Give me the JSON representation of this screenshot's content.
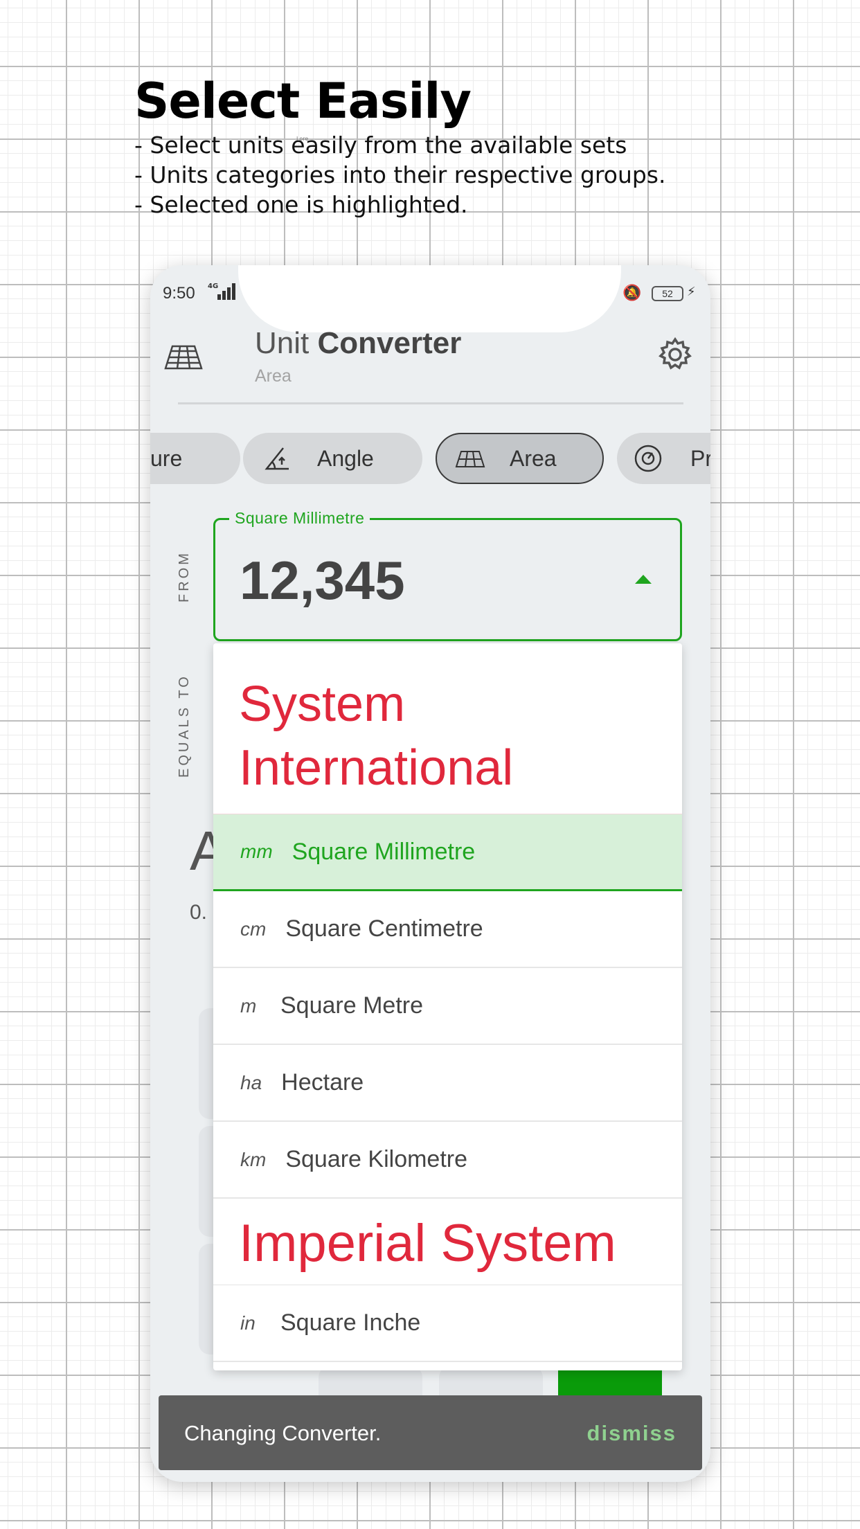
{
  "promo": {
    "title": "Select Easily",
    "tiny_text": "Lore",
    "lines": [
      "- Select units easily from the available sets",
      "- Units categories into their respective groups.",
      "- Selected one is highlighted."
    ]
  },
  "status_bar": {
    "time": "9:50",
    "network": "4G",
    "battery": "52"
  },
  "app": {
    "title_light": "Unit ",
    "title_bold": "Converter",
    "subtitle": "Area"
  },
  "categories": [
    {
      "label": "ure",
      "icon": "thermometer-icon"
    },
    {
      "label": "Angle",
      "icon": "angle-icon"
    },
    {
      "label": "Area",
      "icon": "area-grid-icon",
      "active": true
    },
    {
      "label": "Pr",
      "icon": "pressure-gauge-icon"
    }
  ],
  "side_labels": {
    "from": "FROM",
    "equals_to": "EQUALS TO"
  },
  "from_field": {
    "label": "Square Millimetre",
    "value": "12,345"
  },
  "background_result": {
    "big_letter": "A",
    "value": "0."
  },
  "dropdown": {
    "groups": [
      {
        "title": "System International",
        "units": [
          {
            "abbr": "mm",
            "name": "Square Millimetre",
            "selected": true
          },
          {
            "abbr": "cm",
            "name": "Square Centimetre"
          },
          {
            "abbr": "m",
            "name": "Square Metre"
          },
          {
            "abbr": "ha",
            "name": "Hectare"
          },
          {
            "abbr": "km",
            "name": "Square Kilometre"
          }
        ]
      },
      {
        "title": "Imperial System",
        "units": [
          {
            "abbr": "in",
            "name": "Square Inche"
          }
        ]
      }
    ]
  },
  "snackbar": {
    "message": "Changing Converter.",
    "action": "dismiss"
  },
  "colors": {
    "accent_green": "#1fa51f",
    "group_red": "#e0283c",
    "selected_bg": "#d7f0d9",
    "snackbar_bg": "#5d5d5d"
  }
}
